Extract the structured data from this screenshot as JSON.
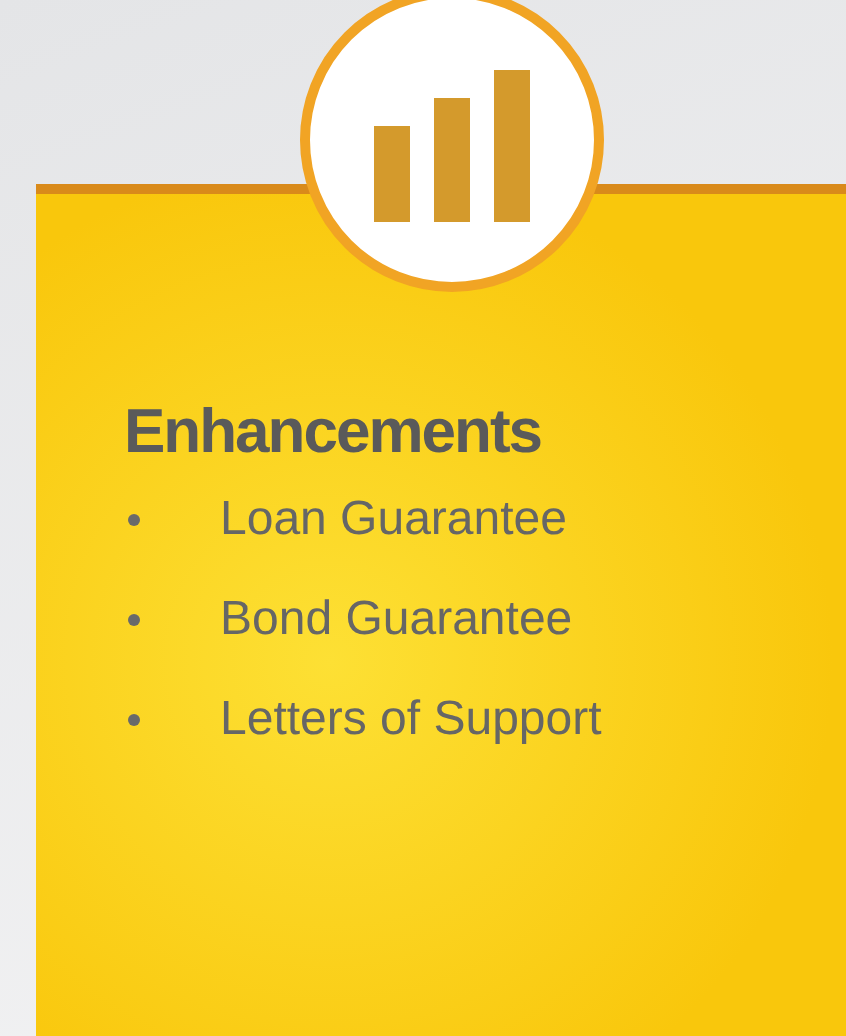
{
  "card": {
    "title": "Enhancements",
    "items": [
      "Loan Guarantee",
      "Bond Guarantee",
      "Letters of Support"
    ]
  }
}
